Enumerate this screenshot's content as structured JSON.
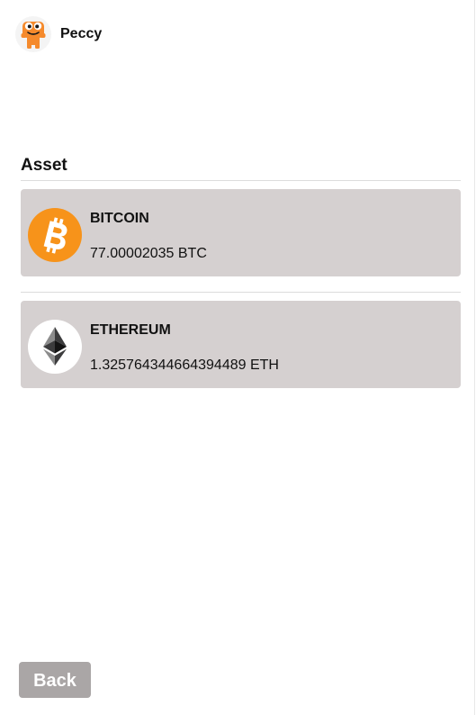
{
  "header": {
    "app_name": "Peccy",
    "logo_icon": "peccy-mascot-icon"
  },
  "assets": {
    "title": "Asset",
    "items": [
      {
        "name": "BITCOIN",
        "balance": "77.00002035 BTC",
        "icon": "bitcoin-icon",
        "icon_color": "#f7931a"
      },
      {
        "name": "ETHEREUM",
        "balance": "1.325764344664394489 ETH",
        "icon": "ethereum-icon",
        "icon_color": "#3c3c3d"
      }
    ]
  },
  "footer": {
    "back_label": "Back"
  },
  "colors": {
    "card_background": "#d5d0d0",
    "button_background": "#aaa6a6",
    "mascot_orange": "#f58a2c"
  }
}
